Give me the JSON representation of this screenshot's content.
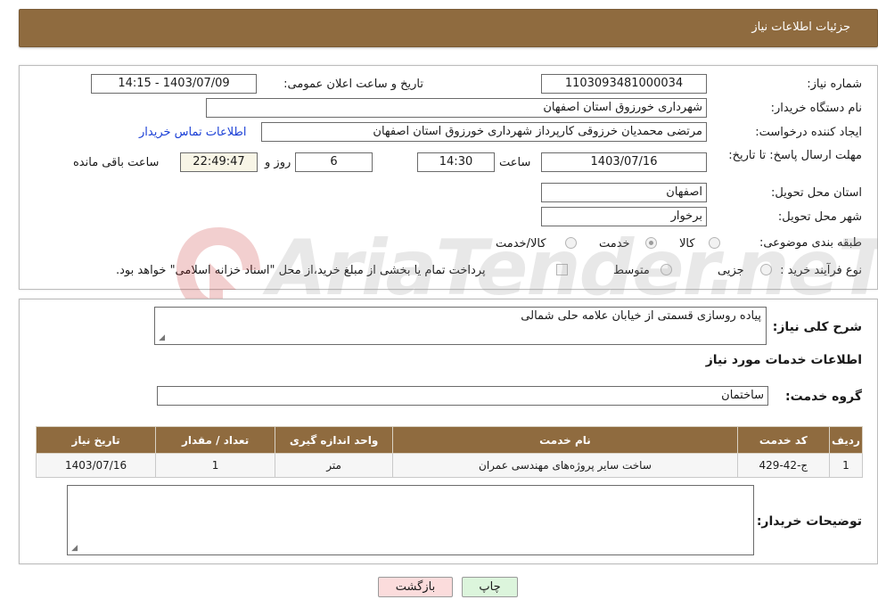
{
  "header": {
    "title": "جزئیات اطلاعات نیاز"
  },
  "details": {
    "need_number_label": "شماره نیاز:",
    "need_number": "1103093481000034",
    "announce_datetime_label": "تاریخ و ساعت اعلان عمومی:",
    "announce_datetime": "1403/07/09 - 14:15",
    "buyer_org_label": "نام دستگاه خریدار:",
    "buyer_org": "شهرداری خورزوق استان اصفهان",
    "requester_label": "ایجاد کننده درخواست:",
    "requester": "مرتضی محمدیان خرزوقی کارپرداز شهرداری خورزوق استان اصفهان",
    "buyer_contact_link": "اطلاعات تماس خریدار",
    "deadline_label": "مهلت ارسال پاسخ: تا تاریخ:",
    "deadline_date": "1403/07/16",
    "time_label": "ساعت",
    "deadline_time": "14:30",
    "days_value": "6",
    "days_label": "روز و",
    "remaining_time": "22:49:47",
    "remaining_label": "ساعت باقی مانده",
    "province_label": "استان محل تحویل:",
    "province": "اصفهان",
    "city_label": "شهر محل تحویل:",
    "city": "برخوار",
    "category_label": "طبقه بندی موضوعی:",
    "category_options": [
      {
        "label": "کالا",
        "checked": false
      },
      {
        "label": "خدمت",
        "checked": true
      },
      {
        "label": "کالا/خدمت",
        "checked": false
      }
    ],
    "process_label": "نوع فرآیند خرید :",
    "process_options": [
      {
        "label": "جزیی",
        "checked": false
      },
      {
        "label": "متوسط",
        "checked": false
      }
    ],
    "payment_note": "پرداخت تمام یا بخشی از مبلغ خرید،از محل \"اسناد خزانه اسلامی\" خواهد بود.",
    "payment_checked": false
  },
  "summary": {
    "general_desc_label": "شرح کلی نیاز:",
    "general_desc": "پیاده روسازی قسمتی از خیابان علامه حلی شمالی",
    "services_title": "اطلاعات خدمات مورد نیاز",
    "service_group_label": "گروه خدمت:",
    "service_group": "ساختمان"
  },
  "table": {
    "columns": [
      "ردیف",
      "کد خدمت",
      "نام خدمت",
      "واحد اندازه گیری",
      "تعداد / مقدار",
      "تاریخ نیاز"
    ],
    "rows": [
      [
        "1",
        "ج-42-429",
        "ساخت سایر پروژه‌های مهندسی عمران",
        "متر",
        "1",
        "1403/07/16"
      ]
    ]
  },
  "buyer_notes": {
    "label": "توضیحات خریدار:",
    "value": ""
  },
  "buttons": {
    "print": "چاپ",
    "back": "بازگشت"
  },
  "watermark": {
    "text": "AriaTender.neT"
  },
  "colors": {
    "header_brown": "#8f6b3f",
    "link_blue": "#1a3fd6",
    "back_bg": "#fbdcdc",
    "print_bg": "#dcf5dc"
  }
}
